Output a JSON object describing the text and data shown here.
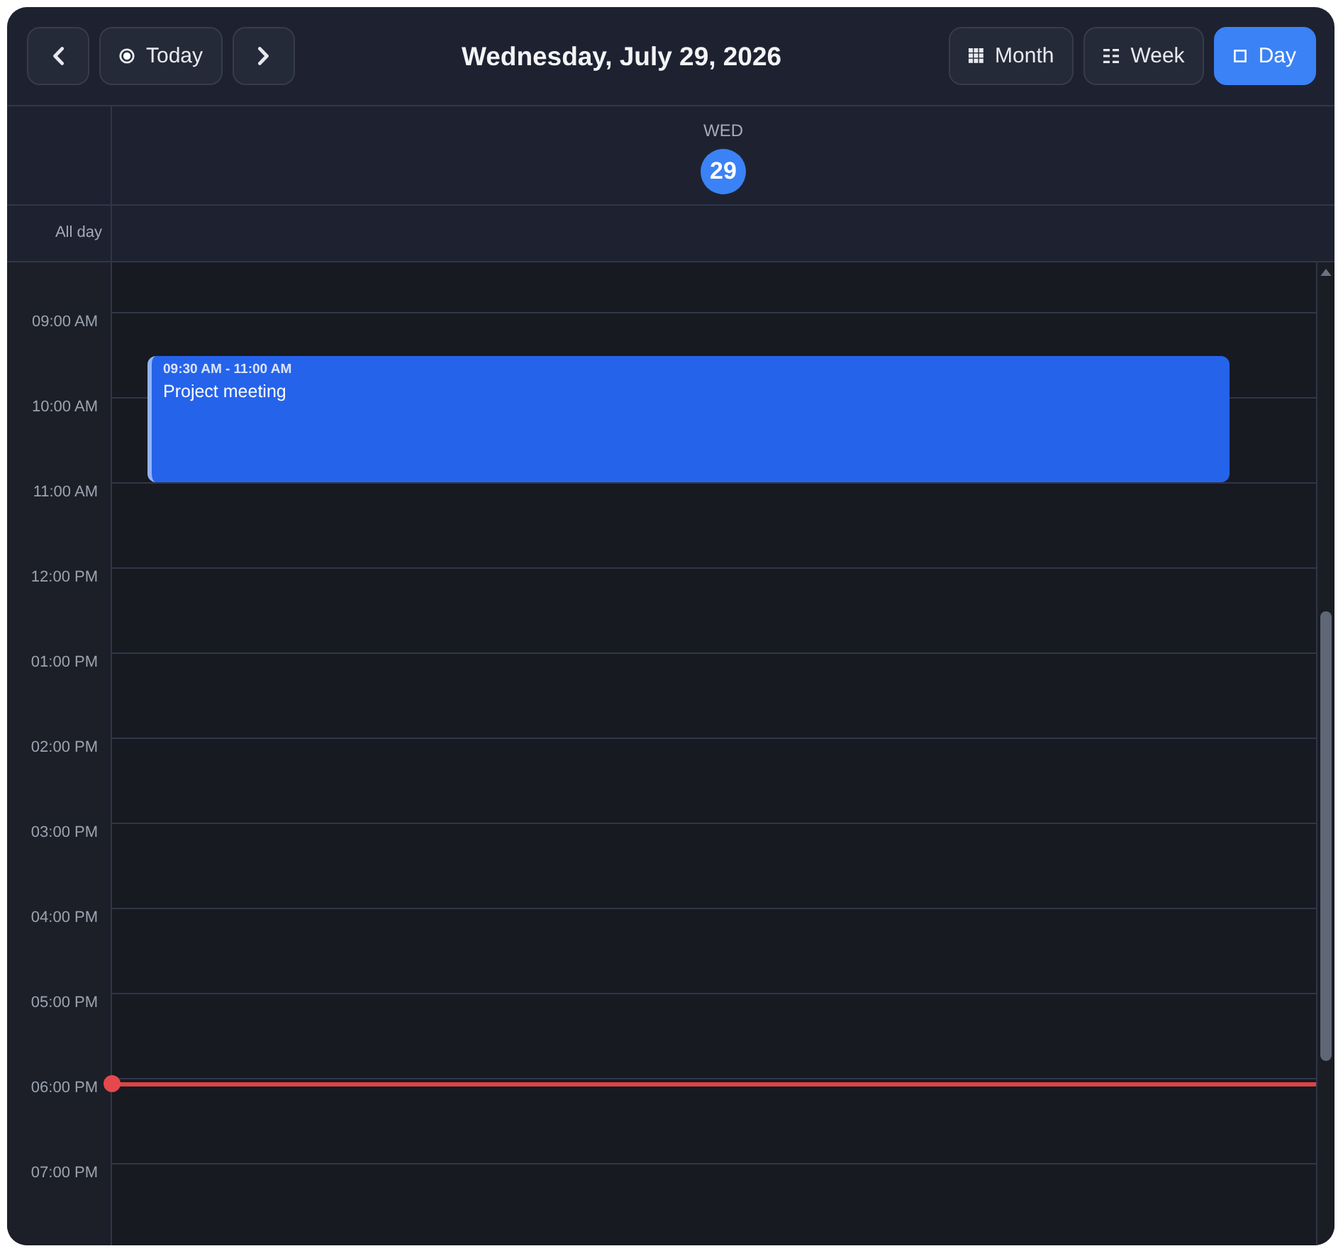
{
  "toolbar": {
    "nav_buttons": [
      {
        "kind": "prev"
      },
      {
        "kind": "today",
        "label": "Today"
      },
      {
        "kind": "next"
      }
    ],
    "title": "Wednesday, July 29, 2026",
    "views": [
      {
        "kind": "month",
        "label": "Month",
        "selected": false
      },
      {
        "kind": "week",
        "label": "Week",
        "selected": false
      },
      {
        "kind": "day",
        "label": "Day",
        "selected": true
      }
    ]
  },
  "day_header": {
    "weekday": "WED",
    "date": "29",
    "today": true
  },
  "all_day": {
    "label": "All day"
  },
  "hours": [
    "09:00 AM",
    "10:00 AM",
    "11:00 AM",
    "12:00 PM",
    "01:00 PM",
    "02:00 PM",
    "03:00 PM",
    "04:00 PM",
    "05:00 PM",
    "06:00 PM",
    "07:00 PM"
  ],
  "events": [
    {
      "time": "09:30 AM - 11:00 AM",
      "title": "Project meeting"
    }
  ],
  "now_indicator": true
}
